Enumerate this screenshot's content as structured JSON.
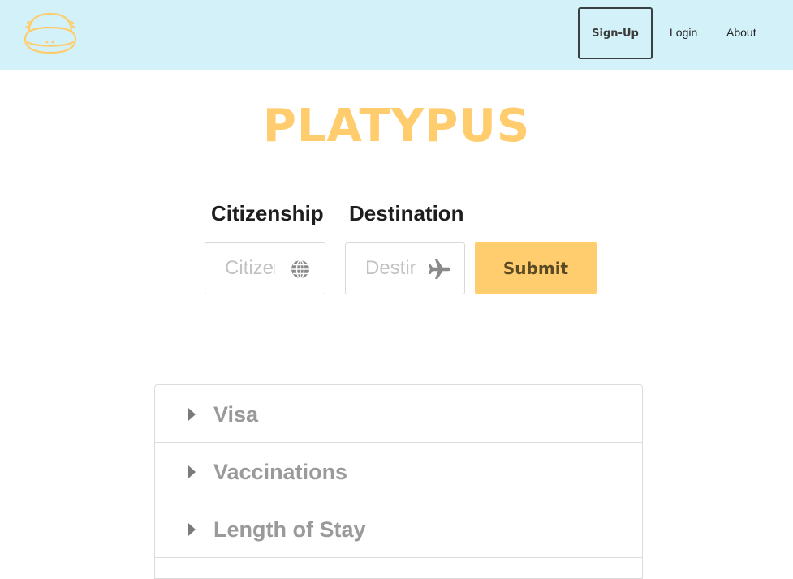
{
  "header": {
    "logo_icon": "platypus-logo-icon",
    "nav": {
      "signup_label": "Sign-Up",
      "login_label": "Login",
      "about_label": "About"
    },
    "background_color": "#d3f1f8"
  },
  "brand": {
    "title": "PLATYPUS",
    "color": "#ffcd6e"
  },
  "form": {
    "citizenship": {
      "label": "Citizenship",
      "placeholder": "Citizenship",
      "value": "",
      "icon": "globe-icon"
    },
    "destination": {
      "label": "Destination",
      "placeholder": "Destination",
      "value": "",
      "icon": "airplane-icon"
    },
    "submit_label": "Submit"
  },
  "accordion": {
    "items": [
      {
        "label": "Visa",
        "icon": "caret-right-icon"
      },
      {
        "label": "Vaccinations",
        "icon": "caret-right-icon"
      },
      {
        "label": "Length of Stay",
        "icon": "caret-right-icon"
      }
    ]
  }
}
